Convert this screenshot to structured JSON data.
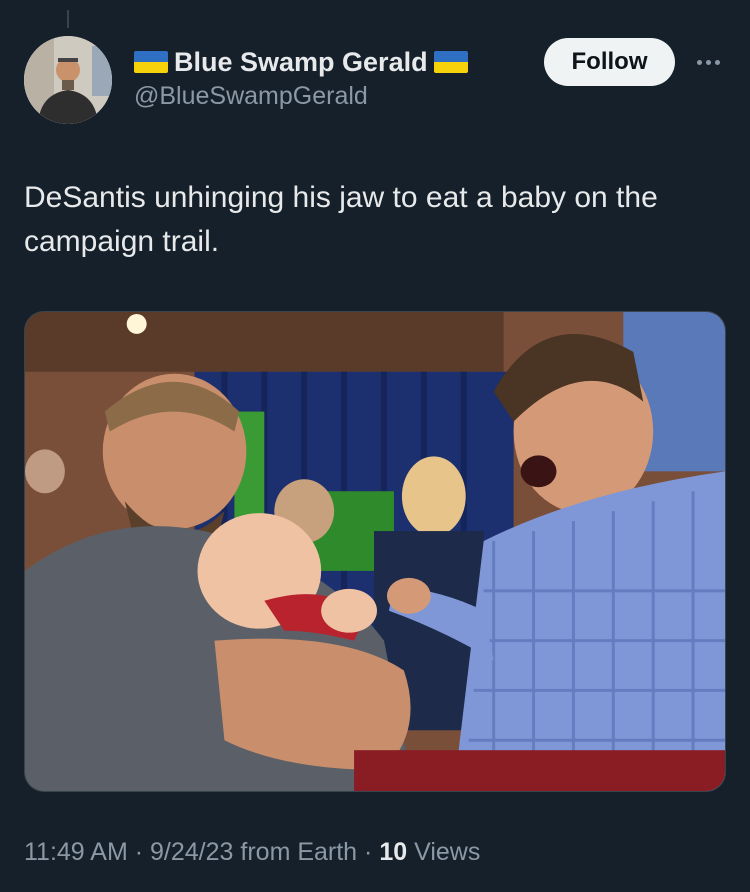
{
  "author": {
    "display_name": "Blue Swamp Gerald",
    "handle": "@BlueSwampGerald",
    "flag_icon": "ukraine-flag-icon",
    "flag_colors": [
      "#2f6fc4",
      "#f5d20a"
    ]
  },
  "actions": {
    "follow_label": "Follow",
    "more_icon": "more-options-icon"
  },
  "tweet": {
    "text": "DeSantis unhinging his jaw to eat a baby on the campaign trail."
  },
  "meta": {
    "time": "11:49 AM",
    "date": "9/24/23",
    "source": "from Earth",
    "views_count": "10",
    "views_label": "Views"
  },
  "colors": {
    "background": "#15202b",
    "text_primary": "#e7e9ea",
    "text_secondary": "#8b98a5",
    "follow_bg": "#eff3f4"
  }
}
